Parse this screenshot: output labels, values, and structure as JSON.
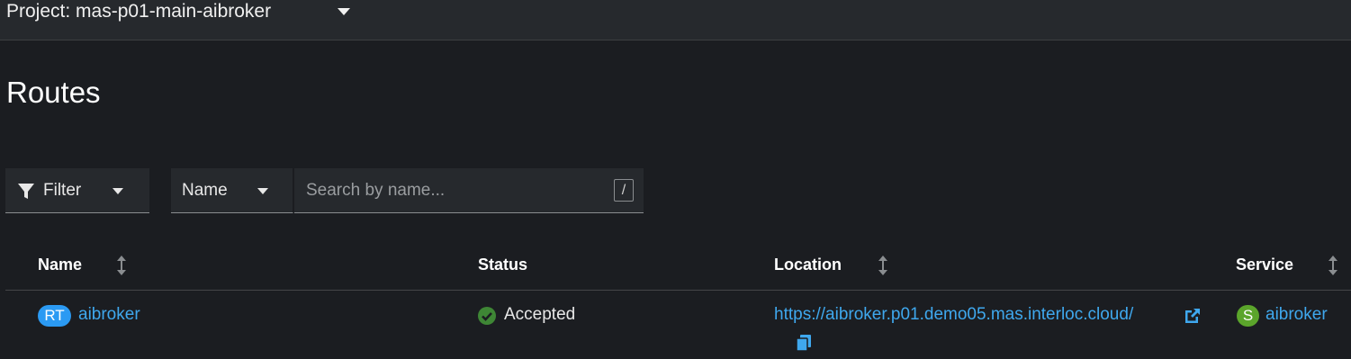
{
  "project": {
    "label": "Project: mas-p01-main-aibroker"
  },
  "page": {
    "title": "Routes"
  },
  "toolbar": {
    "filter_label": "Filter",
    "attribute_select": "Name",
    "search_placeholder": "Search by name...",
    "search_value": "",
    "shortcut_key": "/"
  },
  "table": {
    "columns": [
      "Name",
      "Status",
      "Location",
      "Service"
    ],
    "rows": [
      {
        "name_badge": "RT",
        "name": "aibroker",
        "status": "Accepted",
        "location": "https://aibroker.p01.demo05.mas.interloc.cloud/",
        "service_badge": "S",
        "service": "aibroker"
      }
    ]
  },
  "colors": {
    "background": "#1b1d21",
    "link": "#3fa8ee",
    "route_badge": "#2b9af3",
    "service_badge": "#5ba52b",
    "status_ok": "#3e8635"
  },
  "icons": {
    "project_caret": "caret-down-icon",
    "filter": "filter-icon",
    "sort": "sort-icon",
    "status": "check-circle-icon",
    "external_link": "external-link-icon",
    "copy": "copy-icon"
  }
}
